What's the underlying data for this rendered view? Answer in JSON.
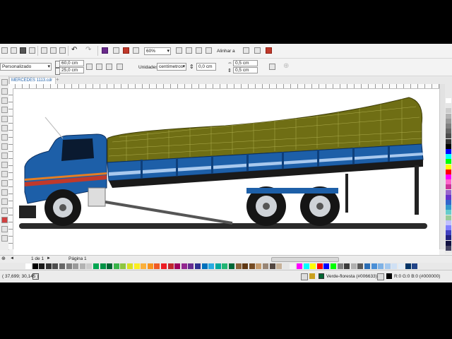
{
  "toolbar1": {
    "zoom_value": "60%",
    "snap_label": "Alinhar a"
  },
  "toolbar2": {
    "preset_value": "Personalizado",
    "width_value": "60,0 cm",
    "height_value": "25,0 cm",
    "units_label": "Unidades:",
    "units_value": "centímetros",
    "nudge_value": "0,0 cm",
    "dup_x_value": "0,5 cm",
    "dup_y_value": "0,5 cm"
  },
  "document_tab": "MERCEDES 1113.cdr",
  "page_nav": {
    "page_count": "1 de 1",
    "page_tab": "Página 1"
  },
  "status_bar": {
    "coordinates": "( 37,699; 30,145 )",
    "fill_label": "Verde-floresta (#006633)",
    "outline_label": "R:0 G:0 B:0 (#000000)"
  },
  "colors": {
    "truck_blue": "#1d5fa8",
    "tarp_olive": "#6f6e14",
    "fill_swatch": "#006633",
    "outline_swatch": "#000000"
  },
  "palette_bottom": [
    "#ffffff",
    "#000000",
    "#1a1a1a",
    "#333333",
    "#4d4d4d",
    "#666666",
    "#808080",
    "#999999",
    "#b3b3b3",
    "#cccccc",
    "#00a651",
    "#009245",
    "#006633",
    "#39b54a",
    "#8dc63f",
    "#d9e021",
    "#fcee21",
    "#fbb03b",
    "#f7931e",
    "#f15a24",
    "#ed1c24",
    "#c1272d",
    "#9e005d",
    "#93278f",
    "#662d91",
    "#2e3192",
    "#0071bc",
    "#29abe2",
    "#00a99d",
    "#22b573",
    "#006837",
    "#8c6239",
    "#603813",
    "#754c24",
    "#c69c6d",
    "#998675",
    "#534741",
    "#c7b299",
    "#e6e6e6",
    "#f2f2f2",
    "#ff00ff",
    "#00ffff",
    "#ffff00",
    "#ff0000",
    "#0000ff",
    "#00ff00",
    "#7f7f7f",
    "#3c3c3c",
    "#b0b0b0",
    "#5a5a5a",
    "#2a6db5",
    "#4a8fd6",
    "#7fb2e5",
    "#a3c8ee",
    "#cfe0f4",
    "#e0ecf8",
    "#003366",
    "#224488"
  ],
  "palette_right": [
    "#ffffff",
    "#e6e6e6",
    "#cccccc",
    "#b3b3b3",
    "#999999",
    "#808080",
    "#666666",
    "#4d4d4d",
    "#333333",
    "#000000",
    "#0000ff",
    "#00ffff",
    "#00ff00",
    "#ffff00",
    "#ff0000",
    "#ff00ff",
    "#ff66cc",
    "#cc3399",
    "#9966cc",
    "#6633cc",
    "#3366cc",
    "#3399cc",
    "#66cccc",
    "#99cc99",
    "#c0c0ff",
    "#8080ff",
    "#4040c0",
    "#202080",
    "#101040",
    "#404060"
  ]
}
